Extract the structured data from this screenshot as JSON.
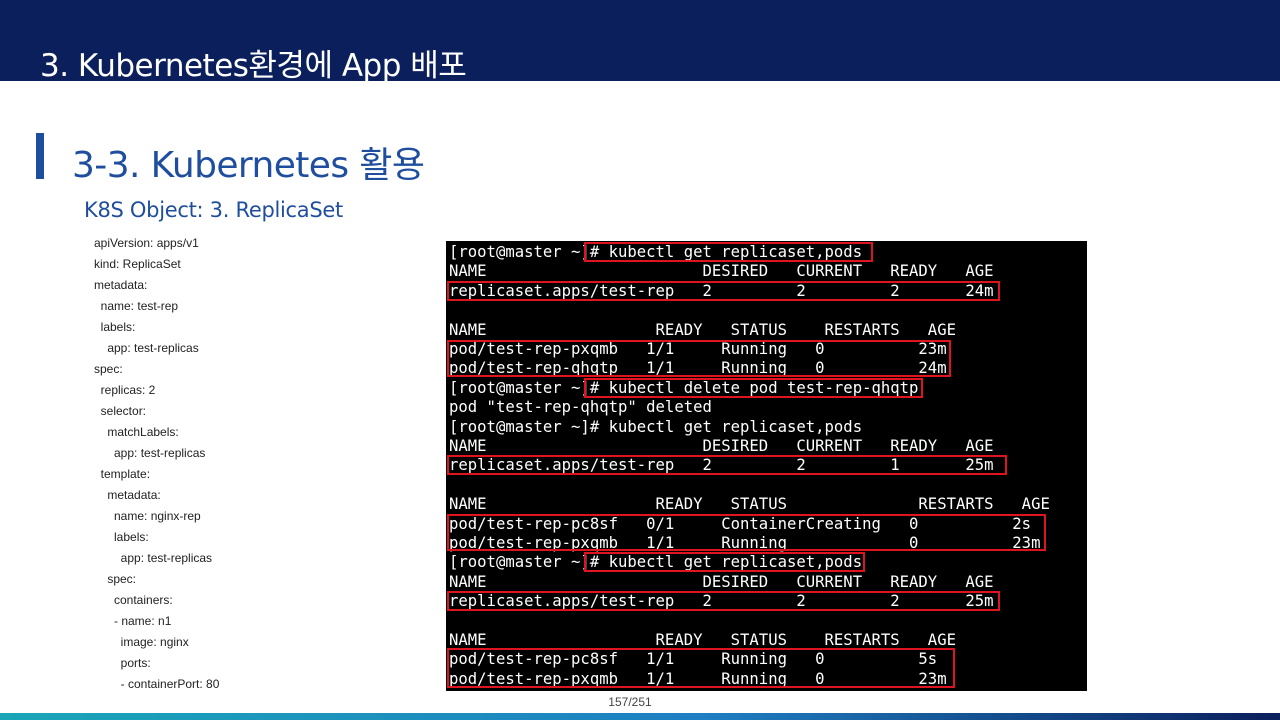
{
  "header": {
    "title": "3.  Kubernetes환경에 App 배포"
  },
  "section": {
    "title": "3-3. Kubernetes 활용"
  },
  "subsection": {
    "title": "K8S Object: 3. ReplicaSet"
  },
  "yaml_lines": [
    "apiVersion: apps/v1",
    "kind: ReplicaSet",
    "metadata:",
    "  name: test-rep",
    "  labels:",
    "    app: test-replicas",
    "spec:",
    "  replicas: 2",
    "  selector:",
    "    matchLabels:",
    "      app: test-replicas",
    "  template:",
    "    metadata:",
    "      name: nginx-rep",
    "      labels:",
    "        app: test-replicas",
    "    spec:",
    "      containers:",
    "      - name: n1",
    "        image: nginx",
    "        ports:",
    "        - containerPort: 80"
  ],
  "terminal_lines": [
    "[root@master ~]# kubectl get replicaset,pods",
    "NAME                       DESIRED   CURRENT   READY   AGE",
    "replicaset.apps/test-rep   2         2         2       24m",
    "",
    "NAME                  READY   STATUS    RESTARTS   AGE",
    "pod/test-rep-pxqmb   1/1     Running   0          23m",
    "pod/test-rep-qhqtp   1/1     Running   0          24m",
    "[root@master ~]# kubectl delete pod test-rep-qhqtp",
    "pod \"test-rep-qhqtp\" deleted",
    "[root@master ~]# kubectl get replicaset,pods",
    "NAME                       DESIRED   CURRENT   READY   AGE",
    "replicaset.apps/test-rep   2         2         1       25m",
    "",
    "NAME                  READY   STATUS              RESTARTS   AGE",
    "pod/test-rep-pc8sf   0/1     ContainerCreating   0          2s",
    "pod/test-rep-pxqmb   1/1     Running             0          23m",
    "[root@master ~]# kubectl get replicaset,pods",
    "NAME                       DESIRED   CURRENT   READY   AGE",
    "replicaset.apps/test-rep   2         2         2       25m",
    "",
    "NAME                  READY   STATUS    RESTARTS   AGE",
    "pod/test-rep-pc8sf   1/1     Running   0          5s",
    "pod/test-rep-pxqmb   1/1     Running   0          23m"
  ],
  "footer": {
    "page": "157/251"
  },
  "colors": {
    "header_bg": "#0b1f5c",
    "accent": "#1f4e9e",
    "highlight": "#e0141e"
  }
}
